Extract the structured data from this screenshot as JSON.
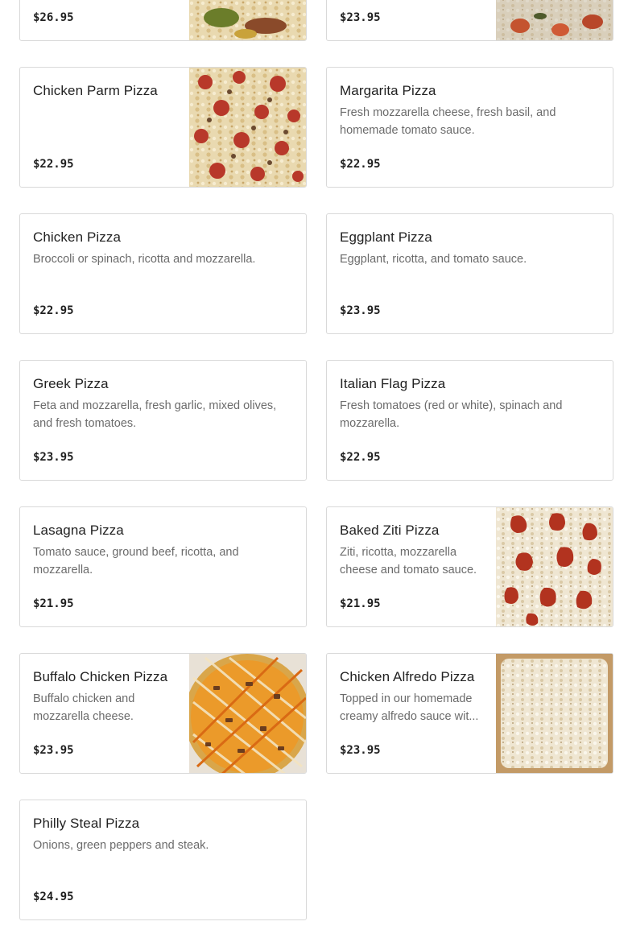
{
  "items": [
    {
      "name": "",
      "description": "",
      "price": "$26.95",
      "image": "pizza-photo-mixed"
    },
    {
      "name": "",
      "description": "",
      "price": "$23.95",
      "image": "pizza-photo-tomato"
    },
    {
      "name": "Chicken Parm Pizza",
      "description": "",
      "price": "$22.95",
      "image": "pizza-photo-pepperoni"
    },
    {
      "name": "Margarita Pizza",
      "description": "Fresh mozzarella cheese, fresh basil, and homemade tomato sauce.",
      "price": "$22.95"
    },
    {
      "name": "Chicken Pizza",
      "description": "Broccoli or spinach, ricotta and mozzarella.",
      "price": "$22.95"
    },
    {
      "name": "Eggplant Pizza",
      "description": "Eggplant, ricotta, and tomato sauce.",
      "price": "$23.95"
    },
    {
      "name": "Greek Pizza",
      "description": "Feta and mozzarella, fresh garlic, mixed olives, and fresh tomatoes.",
      "price": "$23.95"
    },
    {
      "name": "Italian Flag Pizza",
      "description": "Fresh tomatoes (red or white), spinach and mozzarella.",
      "price": "$22.95"
    },
    {
      "name": "Lasagna Pizza",
      "description": "Tomato sauce, ground beef, ricotta, and mozzarella.",
      "price": "$21.95"
    },
    {
      "name": "Baked Ziti Pizza",
      "description": "Ziti, ricotta, mozzarella cheese and tomato sauce.",
      "price": "$21.95",
      "image": "pizza-photo-sauce-dollops"
    },
    {
      "name": "Buffalo Chicken Pizza",
      "description": "Buffalo chicken and mozzarella cheese.",
      "price": "$23.95",
      "image": "pizza-photo-buffalo"
    },
    {
      "name": "Chicken Alfredo Pizza",
      "description": "Topped in our homemade creamy alfredo sauce wit...",
      "price": "$23.95",
      "image": "pizza-photo-white"
    },
    {
      "name": "Philly Steal Pizza",
      "description": "Onions, green peppers and steak.",
      "price": "$24.95"
    }
  ]
}
